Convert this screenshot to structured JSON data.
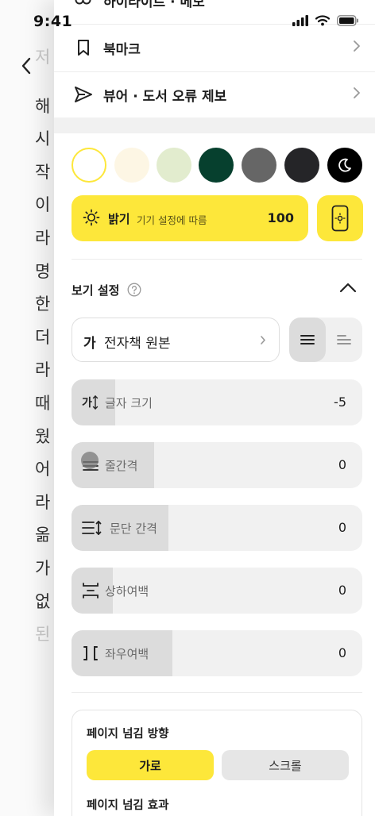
{
  "status": {
    "time": "9:41"
  },
  "reader": {
    "chars": [
      "저",
      "해",
      "시",
      "작",
      "이",
      "라",
      "명",
      "한",
      "더",
      "라",
      "때",
      "웠",
      "어",
      "라",
      "옮",
      "가",
      "없",
      "된"
    ]
  },
  "menu": {
    "partial_label": "하이라이트 · 메모",
    "bookmark_label": "북마크",
    "report_label": "뷰어 · 도서 오류 제보"
  },
  "themes": [
    {
      "name": "white",
      "color": "#ffffff"
    },
    {
      "name": "cream",
      "color": "#fdf6e4"
    },
    {
      "name": "sage",
      "color": "#e2ecce"
    },
    {
      "name": "dark-green",
      "color": "#06402e"
    },
    {
      "name": "gray",
      "color": "#666666"
    },
    {
      "name": "charcoal",
      "color": "#252528"
    },
    {
      "name": "black",
      "color": "#000000"
    }
  ],
  "brightness": {
    "label": "밝기",
    "sub": "기기 설정에 따름",
    "value": "100"
  },
  "view_settings": {
    "title": "보기 설정"
  },
  "font": {
    "glyph": "가",
    "name": "전자책 원본"
  },
  "sliders": [
    {
      "key": "font-size",
      "label": "글자 크기",
      "value": "-5",
      "fill": 0.15
    },
    {
      "key": "line-spacing",
      "label": "줄간격",
      "value": "0",
      "fill": 0.28
    },
    {
      "key": "paragraph-spacing",
      "label": "문단 간격",
      "value": "0",
      "fill": 0.33
    },
    {
      "key": "vertical-margin",
      "label": "상하여백",
      "value": "0",
      "fill": 0.14
    },
    {
      "key": "horizontal-margin",
      "label": "좌우여백",
      "value": "0",
      "fill": 0.35
    }
  ],
  "page_turn": {
    "direction_title": "페이지 넘김 방향",
    "option_on": "가로",
    "option_off": "스크롤",
    "effect_title": "페이지 넘김 효과"
  },
  "colors": {
    "accent": "#fde73a"
  }
}
